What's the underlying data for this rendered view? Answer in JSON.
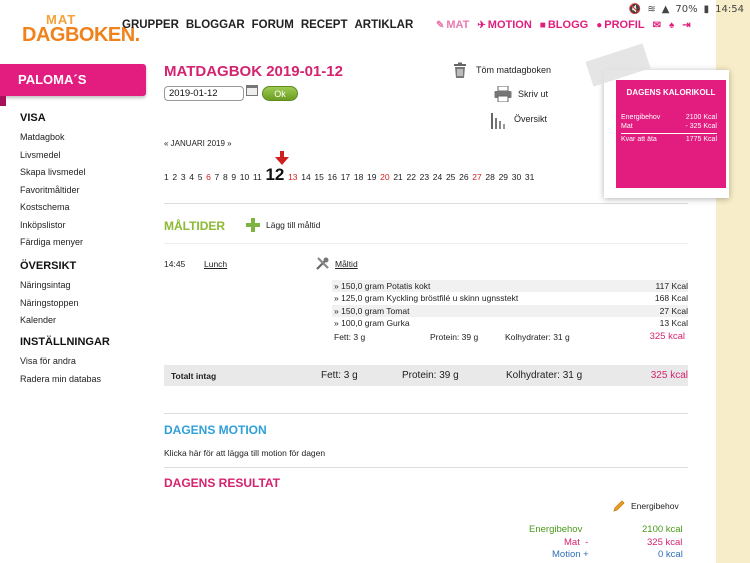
{
  "status": {
    "battery": "70%",
    "time": "14:54"
  },
  "logo": {
    "top": "MAT",
    "bottom": "DAGBOKEN."
  },
  "topnav": [
    "GRUPPER",
    "BLOGGAR",
    "FORUM",
    "RECEPT",
    "ARTIKLAR"
  ],
  "rightnav": {
    "mat": "MAT",
    "motion": "MOTION",
    "blogg": "BLOGG",
    "profil": "PROFIL"
  },
  "sidebar": {
    "name": "PALOMA´S",
    "visa": {
      "title": "VISA",
      "items": [
        "Matdagbok",
        "Livsmedel",
        "Skapa livsmedel",
        "Favoritmåltider",
        "Kostschema",
        "Inköpslistor",
        "Färdiga menyer"
      ]
    },
    "oversikt": {
      "title": "ÖVERSIKT",
      "items": [
        "Näringsintag",
        "Näringstoppen",
        "Kalender"
      ]
    },
    "installningar": {
      "title": "INSTÄLLNINGAR",
      "items": [
        "Visa för andra",
        "Radera min databas"
      ]
    }
  },
  "main": {
    "title": "MATDAGBOK 2019-01-12",
    "date_value": "2019-01-12",
    "ok_label": "Ok",
    "tools": {
      "clear": "Töm matdagboken",
      "print": "Skriv ut",
      "overview": "Översikt"
    }
  },
  "kcal_box": {
    "title": "DAGENS KALORIKOLL",
    "rows": [
      {
        "label": "Energibehov",
        "value": "2100 Kcal"
      },
      {
        "label": "Mat",
        "value": "- 325 Kcal"
      },
      {
        "label": "Kvar att äta",
        "value": "1775 Kcal"
      }
    ]
  },
  "calendar": {
    "month": "« JANUARI 2019 »",
    "days": [
      "1",
      "2",
      "3",
      "4",
      "5",
      "6",
      "7",
      "8",
      "9",
      "10",
      "11",
      "12",
      "13",
      "14",
      "15",
      "16",
      "17",
      "18",
      "19",
      "20",
      "21",
      "22",
      "23",
      "24",
      "25",
      "26",
      "27",
      "28",
      "29",
      "30",
      "31"
    ],
    "red_days": [
      "6",
      "13",
      "20",
      "27"
    ],
    "selected": "12"
  },
  "meals": {
    "title": "MÅLTIDER",
    "add_label": "Lägg till måltid",
    "time": "14:45",
    "name": "Lunch",
    "maltid_label": "Måltid",
    "foods": [
      {
        "name": "» 150,0 gram Potatis kokt",
        "kcal": "117 Kcal"
      },
      {
        "name": "» 125,0 gram Kyckling bröstfilé u skinn ugnsstekt",
        "kcal": "168 Kcal"
      },
      {
        "name": "» 150,0 gram Tomat",
        "kcal": "27 Kcal"
      },
      {
        "name": "» 100,0 gram Gurka",
        "kcal": "13 Kcal"
      }
    ],
    "sum": {
      "fett": "Fett: 3 g",
      "protein": "Protein: 39 g",
      "kolhydrater": "Kolhydrater: 31 g",
      "kcal": "325 kcal"
    }
  },
  "total": {
    "label": "Totalt intag",
    "fett": "Fett: 3 g",
    "protein": "Protein: 39 g",
    "kolhydrater": "Kolhydrater: 31 g",
    "kcal": "325 kcal"
  },
  "motion": {
    "title": "DAGENS MOTION",
    "text": "Klicka här för att lägga till motion för dagen"
  },
  "result": {
    "title": "DAGENS RESULTAT",
    "energ_link": "Energibehov",
    "rows": [
      {
        "label": "Energibehov",
        "value": "2100 kcal"
      },
      {
        "label": "Mat  -",
        "value": "325 kcal"
      },
      {
        "label": "Motion +",
        "value": "0 kcal"
      }
    ]
  },
  "colors": {
    "brand_pink": "#e31d7f",
    "green": "#8cba32",
    "blue": "#2fa0d8",
    "red": "#d01f1f"
  }
}
